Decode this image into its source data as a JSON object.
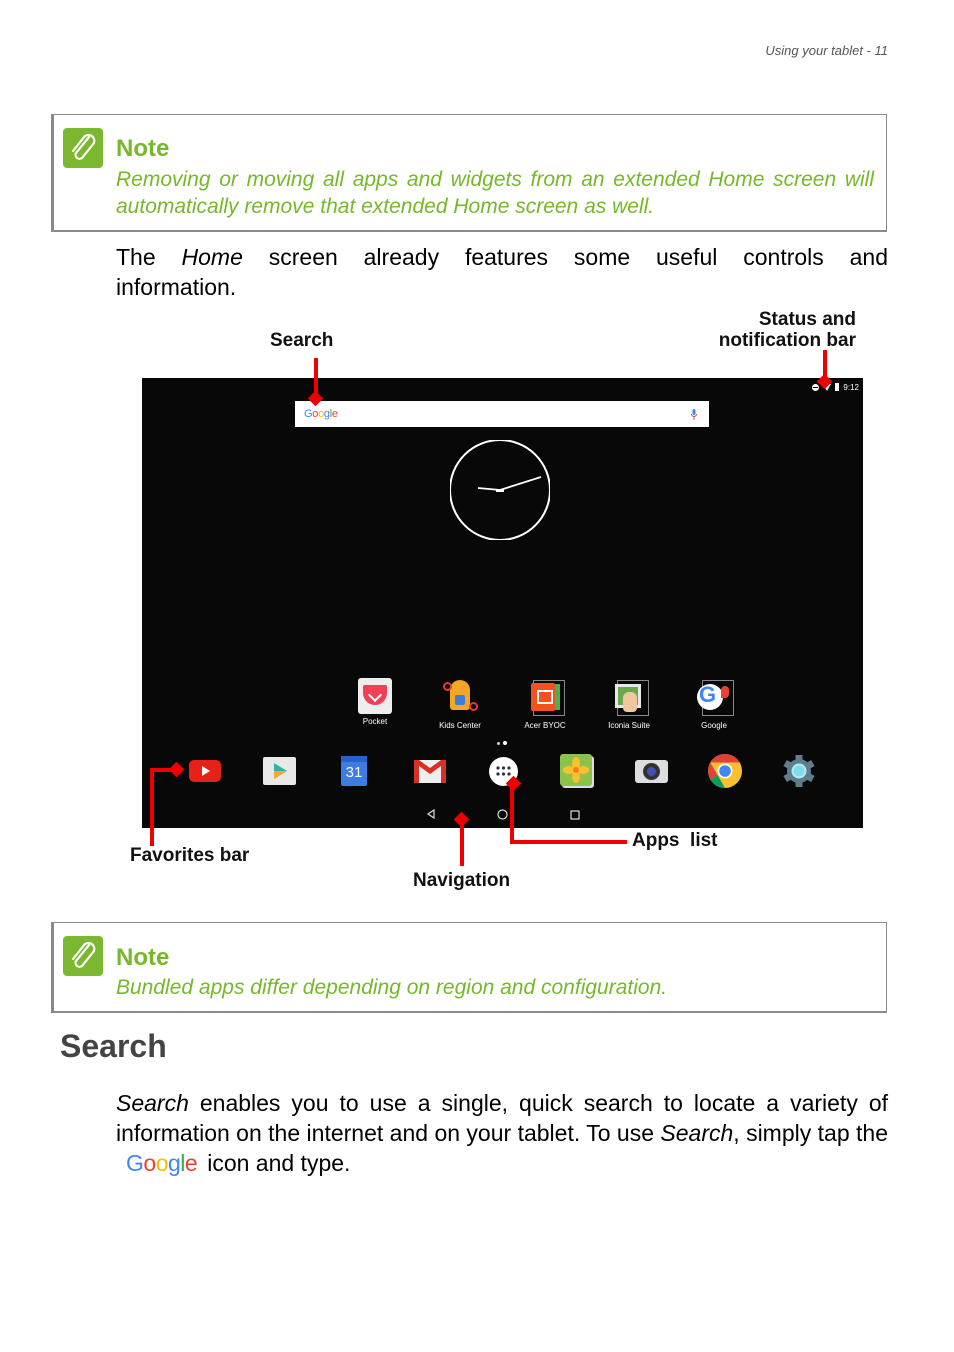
{
  "page_header": "Using your tablet - 11",
  "note1": {
    "title": "Note",
    "text": "Removing or moving all apps and widgets from an extended Home screen will automatically remove that extended Home screen as well.",
    "icon": "paperclip-icon"
  },
  "intro": {
    "line1_pre": "The",
    "line1_em": "Home",
    "line1_post": "screen already features some useful controls and",
    "line2": "information."
  },
  "callouts": {
    "search": "Search",
    "status_line1": "Status and",
    "status_line2": "notification bar",
    "favorites": "Favorites bar",
    "apps_list": "Apps  list",
    "navigation": "Navigation"
  },
  "tablet": {
    "status_time": "9:12",
    "search_logo": "Google",
    "colors": {
      "google_blue": "#4285f4",
      "google_red": "#ea4335",
      "google_yellow": "#fbbc05",
      "google_green": "#34a853",
      "callout_red": "#ee0000"
    },
    "home_apps": [
      {
        "label": "Pocket",
        "icon": "pocket-icon"
      },
      {
        "label": "Kids Center",
        "icon": "kids-center-icon"
      },
      {
        "label": "Acer BYOC",
        "icon": "acer-byoc-icon"
      },
      {
        "label": "Iconia Suite",
        "icon": "iconia-suite-icon"
      },
      {
        "label": "Google",
        "icon": "google-folder-icon"
      }
    ],
    "favorites": [
      {
        "icon": "youtube-icon"
      },
      {
        "icon": "play-store-icon"
      },
      {
        "icon": "calendar-icon",
        "text": "31"
      },
      {
        "icon": "gmail-icon"
      },
      {
        "icon": "apps-list-icon"
      },
      {
        "icon": "gallery-icon"
      },
      {
        "icon": "camera-icon"
      },
      {
        "icon": "chrome-icon"
      },
      {
        "icon": "settings-icon"
      }
    ],
    "nav": [
      {
        "icon": "back-icon"
      },
      {
        "icon": "home-icon"
      },
      {
        "icon": "recents-icon"
      }
    ]
  },
  "note2": {
    "title": "Note",
    "text": "Bundled apps differ depending on region and configuration.",
    "icon": "paperclip-icon"
  },
  "search_section": {
    "heading": "Search",
    "p_em1": "Search",
    "p_part1": " enables you to use a single, quick search to locate a variety of information on the internet and on your tablet. To use ",
    "p_em2": "Search",
    "p_part2": ", simply tap the",
    "google_logo": "Google",
    "p_part3": "icon and type."
  }
}
